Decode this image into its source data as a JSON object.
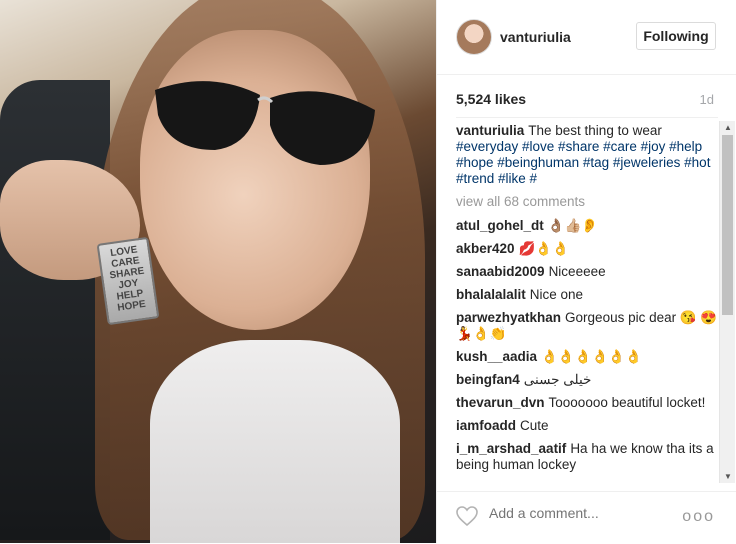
{
  "post": {
    "username": "vanturiulia",
    "follow_label": "Following",
    "likes": "5,524 likes",
    "time": "1d",
    "caption_user": "vanturiulia",
    "caption_text": "The best thing to wear",
    "caption_tags": "#everyday #love #share #care #joy #help #hope #beinghuman #tag #jeweleries #hot #trend #like #",
    "view_all": "view all 68 comments",
    "add_comment_placeholder": "Add a comment...",
    "more_label": "ooo",
    "tag_lines": [
      "LOVE",
      "CARE",
      "SHARE",
      "JOY",
      "HELP",
      "HOPE"
    ]
  },
  "comments": [
    {
      "user": "atul_gohel_dt",
      "text": "👌🏽👍🏼👂"
    },
    {
      "user": "akber420",
      "text": "💋👌👌"
    },
    {
      "user": "sanaabid2009",
      "text": "Niceeeee"
    },
    {
      "user": "bhalalalalit",
      "text": "Nice one"
    },
    {
      "user": "parwezhyatkhan",
      "text": "Gorgeous pic dear 😘 😍💃👌👏"
    },
    {
      "user": "kush__aadia",
      "text": "👌👌👌👌👌👌"
    },
    {
      "user": "beingfan4",
      "text": "خیلی جسنی"
    },
    {
      "user": "thevarun_dvn",
      "text": "Tooooooo beautiful locket!"
    },
    {
      "user": "iamfoadd",
      "text": "Cute"
    },
    {
      "user": "i_m_arshad_aatif",
      "text": "Ha ha we know tha its a being human lockey"
    }
  ],
  "colors": {
    "link": "#003569",
    "muted": "#999999",
    "border": "#efefef"
  }
}
